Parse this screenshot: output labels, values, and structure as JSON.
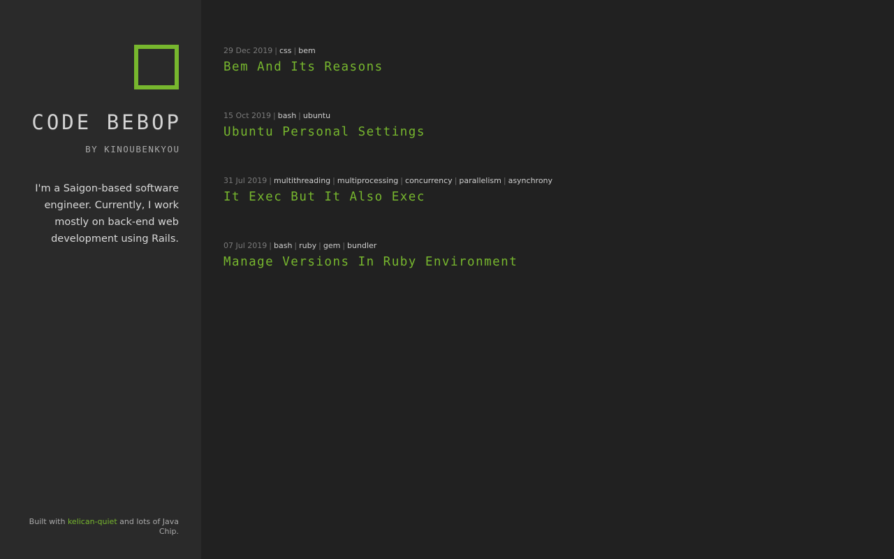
{
  "sidebar": {
    "title": "CODE BEBOP",
    "subtitle": "BY KINOUBENKYOU",
    "bio": "I'm a Saigon-based software engineer. Currently, I work mostly on back-end web development using Rails.",
    "footer": {
      "prefix": "Built with ",
      "link_text": "kelican-quiet",
      "suffix": " and lots of Java Chip."
    }
  },
  "posts": [
    {
      "date": "29 Dec 2019",
      "tags": [
        "css",
        "bem"
      ],
      "title": "Bem And Its Reasons"
    },
    {
      "date": "15 Oct 2019",
      "tags": [
        "bash",
        "ubuntu"
      ],
      "title": "Ubuntu Personal Settings"
    },
    {
      "date": "31 Jul 2019",
      "tags": [
        "multithreading",
        "multiprocessing",
        "concurrency",
        "parallelism",
        "asynchrony"
      ],
      "title": "It Exec But It Also Exec"
    },
    {
      "date": "07 Jul 2019",
      "tags": [
        "bash",
        "ruby",
        "gem",
        "bundler"
      ],
      "title": "Manage Versions In Ruby Environment"
    }
  ],
  "colors": {
    "accent": "#77b72e",
    "sidebar_bg": "#2a2a2a",
    "main_bg": "#212121"
  },
  "icons": {
    "logo": "green-square-outline-logo"
  }
}
